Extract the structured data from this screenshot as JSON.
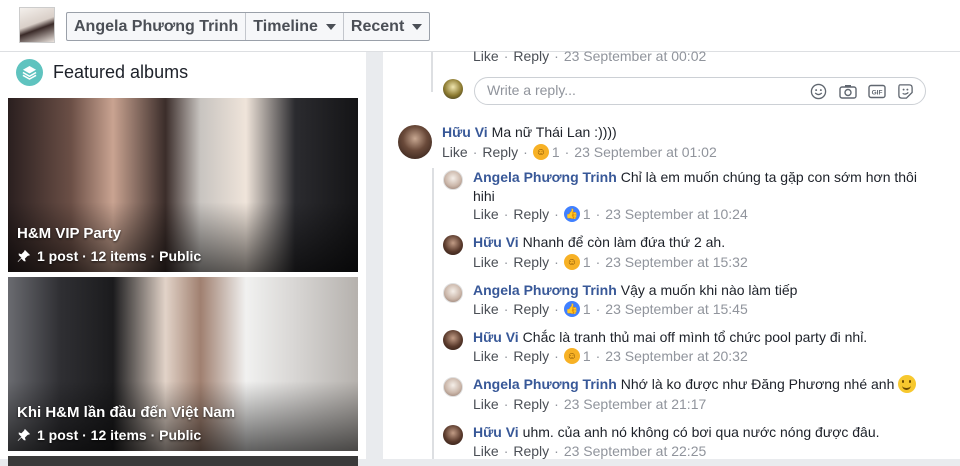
{
  "header": {
    "name": "Angela Phương Trinh",
    "timeline": "Timeline",
    "recent": "Recent"
  },
  "featured": {
    "title": "Featured albums",
    "albums": [
      {
        "title": "H&M VIP Party",
        "meta": "1 post · 12 items · Public"
      },
      {
        "title": "Khi H&M lần đầu đến Việt Nam",
        "meta": "1 post · 12 items · Public"
      }
    ]
  },
  "thread": {
    "top_actions": {
      "like": "Like",
      "reply": "Reply",
      "time": "23 September at 00:02"
    },
    "reply_placeholder": "Write a reply...",
    "main_comment": {
      "author": "Hữu Vi",
      "text": "Ma nữ Thái Lan :))))",
      "like": "Like",
      "reply": "Reply",
      "reaction_count": "1",
      "time": "23 September at 01:02"
    },
    "replies": [
      {
        "author": "Angela Phương Trinh",
        "text": "Chỉ là em muốn chúng ta gặp con sớm hơn thôi",
        "text2": "hihi",
        "like": "Like",
        "reply": "Reply",
        "reaction": "like",
        "reaction_count": "1",
        "time": "23 September at 10:24"
      },
      {
        "author": "Hữu Vi",
        "text": "Nhanh để còn làm đứa thứ 2 ah.",
        "like": "Like",
        "reply": "Reply",
        "reaction": "haha",
        "reaction_count": "1",
        "time": "23 September at 15:32"
      },
      {
        "author": "Angela Phương Trinh",
        "text": "Vậy a muốn khi nào làm tiếp",
        "like": "Like",
        "reply": "Reply",
        "reaction": "like",
        "reaction_count": "1",
        "time": "23 September at 15:45"
      },
      {
        "author": "Hữu Vi",
        "text": "Chắc là tranh thủ mai off mình tổ chức pool party đi nhỉ.",
        "like": "Like",
        "reply": "Reply",
        "reaction": "haha",
        "reaction_count": "1",
        "time": "23 September at 20:32"
      },
      {
        "author": "Angela Phương Trinh",
        "text": "Nhớ là ko được như Đăng Phương nhé anh",
        "like": "Like",
        "reply": "Reply",
        "time": "23 September at 21:17"
      },
      {
        "author": "Hữu Vi",
        "text": "uhm. của anh nó không có bơi qua nước nóng được đâu.",
        "like": "Like",
        "reply": "Reply",
        "time": "23 September at 22:25"
      }
    ]
  }
}
